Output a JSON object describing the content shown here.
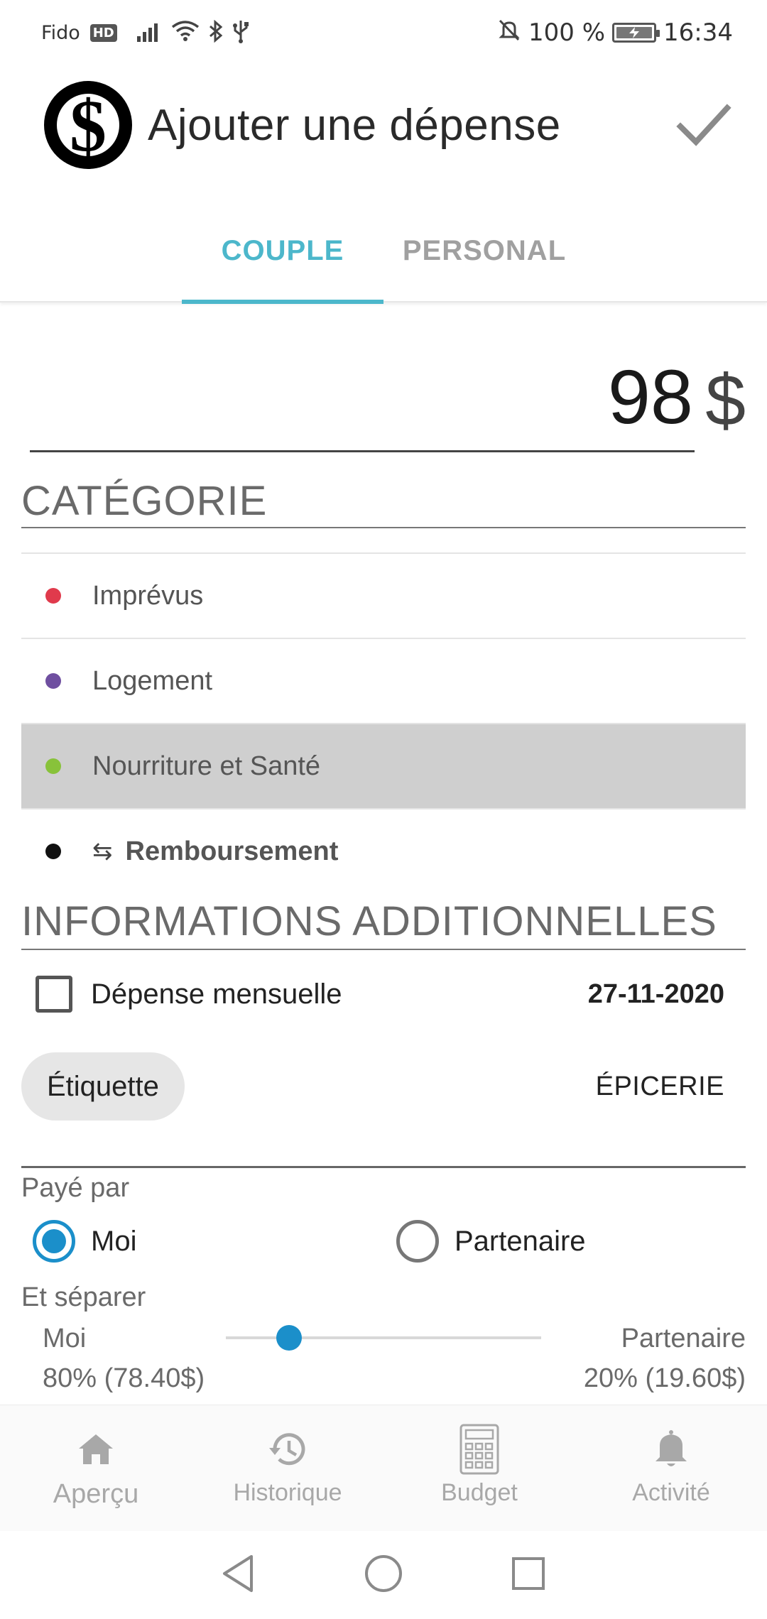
{
  "status_bar": {
    "carrier": "Fido",
    "network_badge": "HD",
    "battery": "100 %",
    "battery_level": 1.0,
    "time": "16:34",
    "icons": [
      "signal-icon",
      "wifi-icon",
      "bluetooth-icon",
      "usb-icon",
      "silent-bell-icon",
      "battery-icon"
    ]
  },
  "app_bar": {
    "title": "Ajouter une dépense",
    "logo_symbol": "$",
    "confirm_icon": "check-icon"
  },
  "tabs": [
    {
      "label": "COUPLE",
      "active": true
    },
    {
      "label": "PERSONAL",
      "active": false
    }
  ],
  "amount": {
    "value": "98",
    "currency": "$"
  },
  "category": {
    "title": "CATÉGORIE",
    "items": [
      {
        "label": "Imprévus",
        "color": "#e03a4c",
        "selected": false
      },
      {
        "label": "Logement",
        "color": "#6f4fa0",
        "selected": false
      },
      {
        "label": "Nourriture et Santé",
        "color": "#88c23a",
        "selected": true
      },
      {
        "label": "Remboursement",
        "color": "#111111",
        "selected": false,
        "prefix_icon": "swap-arrows-icon",
        "prefix_glyph": "⇆"
      }
    ]
  },
  "additional": {
    "title": "INFORMATIONS ADDITIONNELLES",
    "monthly_label": "Dépense mensuelle",
    "monthly_checked": false,
    "date": "27-11-2020",
    "tag_chip": "Étiquette",
    "tag_value": "ÉPICERIE",
    "paid_by_label": "Payé par",
    "paid_by_options": [
      {
        "label": "Moi",
        "checked": true
      },
      {
        "label": "Partenaire",
        "checked": false
      }
    ],
    "split_label": "Et séparer",
    "split": {
      "me_name": "Moi",
      "me_value": "80% (78.40$)",
      "partner_name": "Partenaire",
      "partner_value": "20% (19.60$)",
      "slider_fraction": 0.2
    }
  },
  "bottom_nav": [
    {
      "label": "Aperçu",
      "icon": "home-icon"
    },
    {
      "label": "Historique",
      "icon": "history-icon"
    },
    {
      "label": "Budget",
      "icon": "calculator-icon"
    },
    {
      "label": "Activité",
      "icon": "bell-icon"
    }
  ],
  "system_nav": [
    "back-icon",
    "home-circle-icon",
    "recents-icon"
  ],
  "colors": {
    "accent": "#4cb7cb",
    "radio_active": "#1b8fca",
    "selected_row": "#cfcfcf",
    "muted_text": "#6a6a6a"
  }
}
